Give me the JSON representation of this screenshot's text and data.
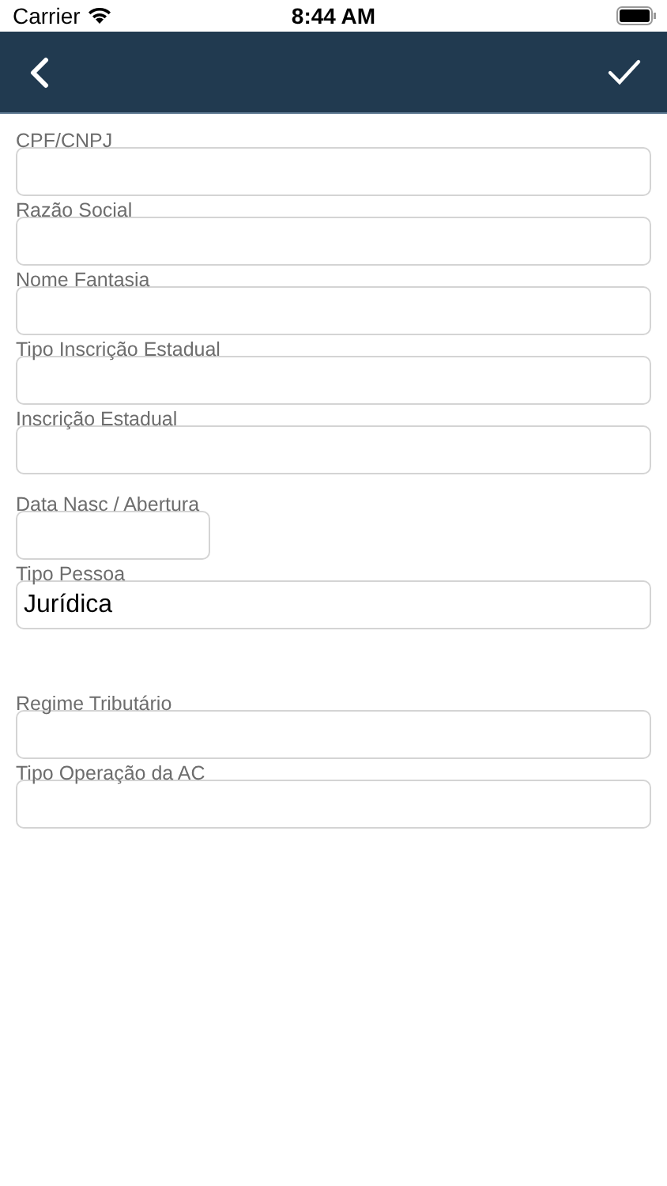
{
  "status_bar": {
    "carrier": "Carrier",
    "time": "8:44 AM"
  },
  "fields": [
    {
      "label": "CPF/CNPJ",
      "kind": "text"
    },
    {
      "label": "Razão Social",
      "kind": "text"
    },
    {
      "label": "Nome Fantasia",
      "kind": "text"
    },
    {
      "label": "Tipo Inscrição Estadual",
      "kind": "text"
    },
    {
      "label": "Inscrição Estadual",
      "kind": "text"
    },
    {
      "label": "Data Nasc / Abertura",
      "kind": "date"
    },
    {
      "label": "Tipo Pessoa",
      "kind": "select",
      "value": "Jurídica"
    },
    {
      "label": "Regime Tributário",
      "kind": "text"
    },
    {
      "label": "Tipo Operação da AC",
      "kind": "text"
    }
  ]
}
